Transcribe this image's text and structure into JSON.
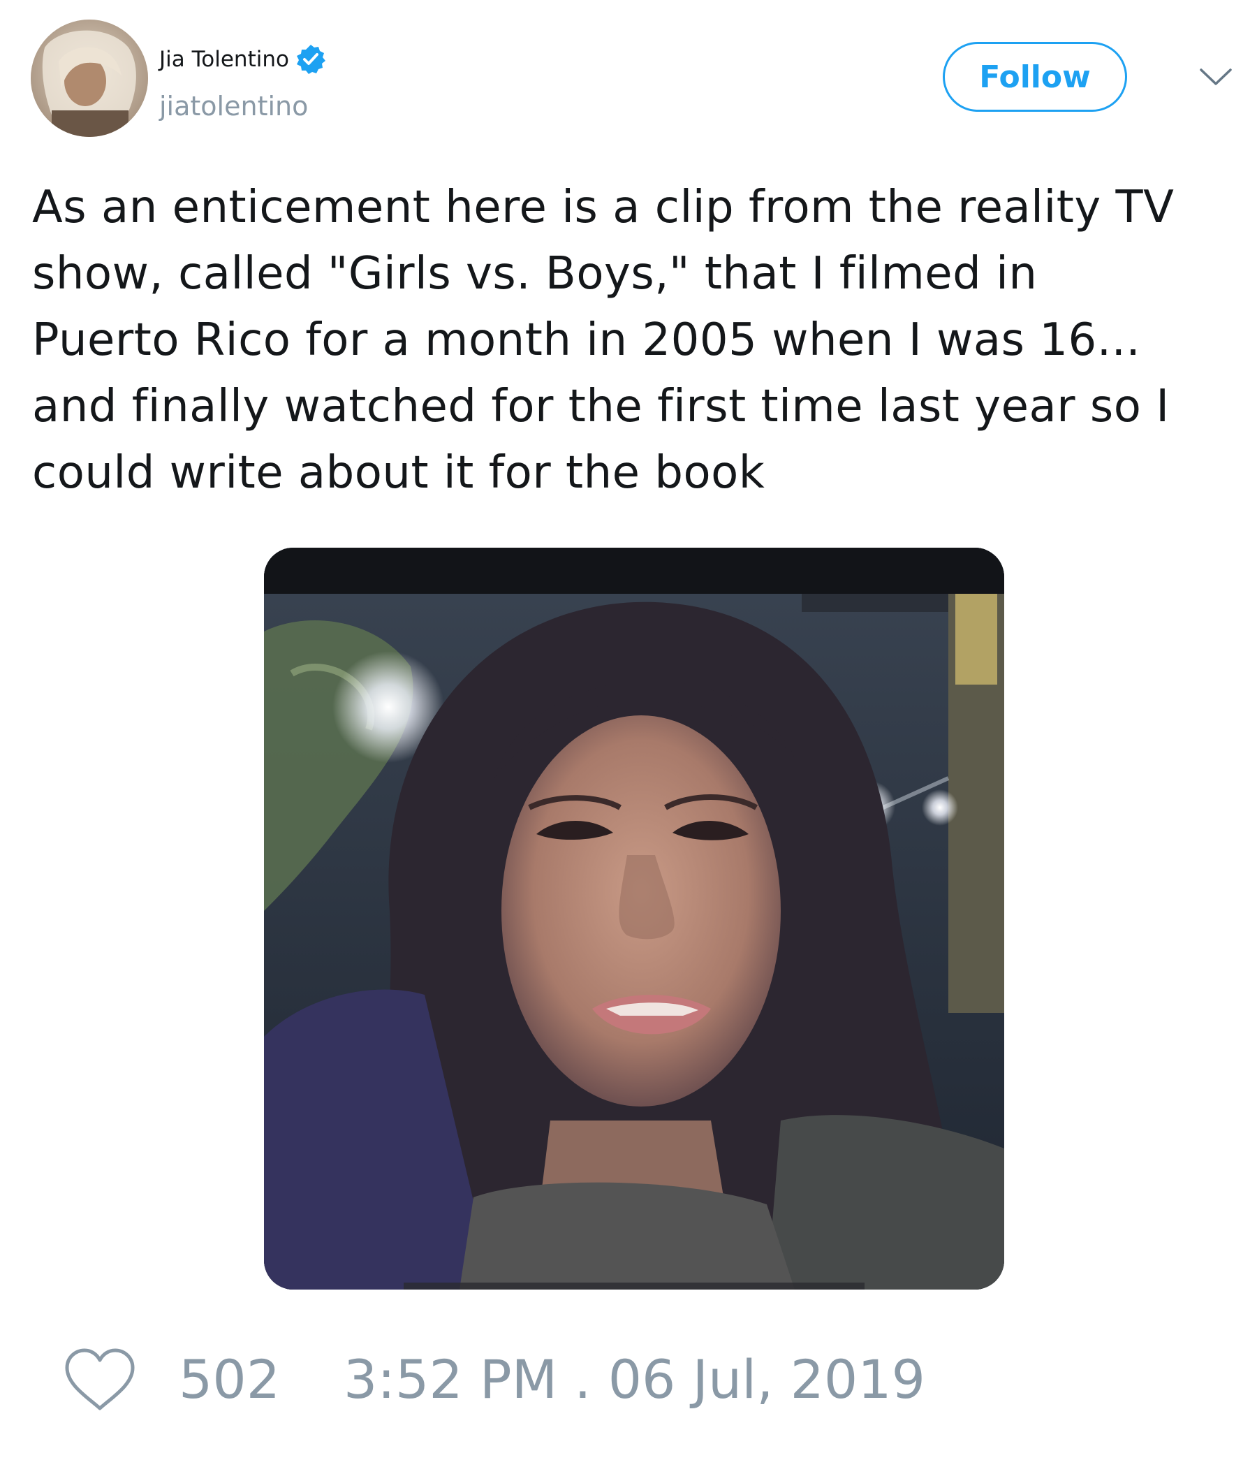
{
  "user": {
    "display_name": "Jia Tolentino",
    "handle": "jiatolentino",
    "verified": true,
    "avatar_icon": "profile-photo"
  },
  "actions": {
    "follow_label": "Follow",
    "menu_icon": "chevron-down-icon"
  },
  "tweet": {
    "text_lines": [
      "As an enticement here is a clip from the reality TV",
      "show, called \"Girls vs. Boys,\" that I filmed in",
      "Puerto Rico for a month in 2005 when I was 16...",
      "and finally watched for the first time last year so I",
      "could write about it for the book"
    ]
  },
  "media": {
    "type": "video-thumbnail"
  },
  "footer": {
    "like_icon": "heart-icon",
    "like_count": "502",
    "timestamp": "3:52 PM . 06 Jul, 2019"
  },
  "colors": {
    "accent": "#1da1f2",
    "muted": "#8a99a6",
    "text": "#14171a"
  }
}
